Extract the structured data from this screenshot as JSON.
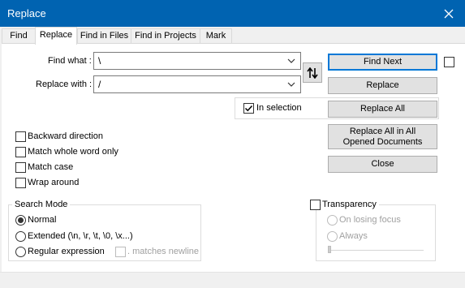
{
  "window": {
    "title": "Replace",
    "close_icon": "close-icon"
  },
  "tabs": [
    {
      "label": "Find"
    },
    {
      "label": "Replace"
    },
    {
      "label": "Find in Files"
    },
    {
      "label": "Find in Projects"
    },
    {
      "label": "Mark"
    }
  ],
  "active_tab": "Replace",
  "form": {
    "find_label": "Find what :",
    "find_value": "\\",
    "replace_label": "Replace with :",
    "replace_value": "/",
    "swap_icon": "swap-arrows-icon",
    "in_selection_label": "In selection",
    "in_selection_checked": true
  },
  "buttons": {
    "find_next": "Find Next",
    "replace": "Replace",
    "replace_all": "Replace All",
    "replace_all_opened": "Replace All in All Opened Documents",
    "close": "Close"
  },
  "options": [
    {
      "label": "Backward direction",
      "checked": false
    },
    {
      "label": "Match whole word only",
      "checked": false
    },
    {
      "label": "Match case",
      "checked": false
    },
    {
      "label": "Wrap around",
      "checked": false
    }
  ],
  "search_mode": {
    "title": "Search Mode",
    "normal": "Normal",
    "extended": "Extended (\\n, \\r, \\t, \\0, \\x...)",
    "regex": "Regular expression",
    "matches_newline": ". matches newline",
    "selected": "Normal"
  },
  "transparency": {
    "label": "Transparency",
    "checked": false,
    "on_losing_focus": "On losing focus",
    "always": "Always"
  }
}
